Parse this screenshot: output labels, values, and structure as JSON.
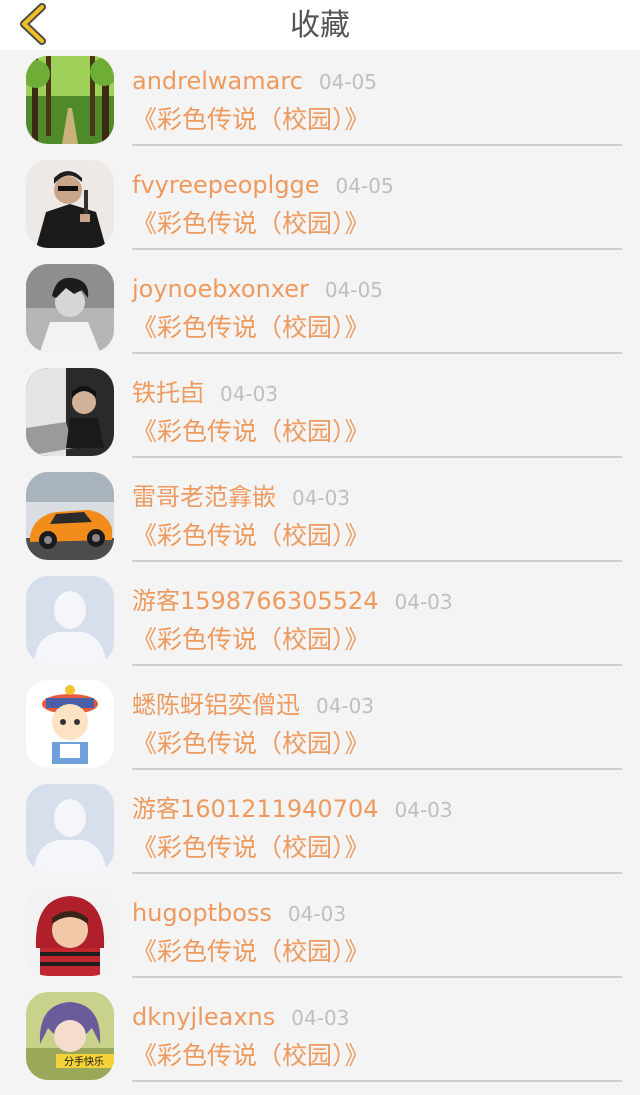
{
  "header": {
    "title": "收藏",
    "back_icon": "chevron-left-icon",
    "accent": "#f0c020"
  },
  "items": [
    {
      "name": "andrelwamarc",
      "date": "04-05",
      "book": "《彩色传说（校园）》",
      "avatar": "forest-path"
    },
    {
      "name": "fvyreepeoplgge",
      "date": "04-05",
      "book": "《彩色传说（校园）》",
      "avatar": "man-with-gun"
    },
    {
      "name": "joynoebxonxer",
      "date": "04-05",
      "book": "《彩色传说（校园）》",
      "avatar": "bw-portrait"
    },
    {
      "name": "铁托卣",
      "date": "04-03",
      "book": "《彩色传说（校园）》",
      "avatar": "person-at-desk"
    },
    {
      "name": "雷哥老范搻嵌",
      "date": "04-03",
      "book": "《彩色传说（校园）》",
      "avatar": "orange-sports-car"
    },
    {
      "name": "游客1598766305524",
      "date": "04-03",
      "book": "《彩色传说（校园）》",
      "avatar": "default-silhouette"
    },
    {
      "name": "蟋陈蚜铝奕僧迅",
      "date": "04-03",
      "book": "《彩色传说（校园）》",
      "avatar": "cartoon-boy"
    },
    {
      "name": "游客1601211940704",
      "date": "04-03",
      "book": "《彩色传说（校园）》",
      "avatar": "default-silhouette"
    },
    {
      "name": "hugoptboss",
      "date": "04-03",
      "book": "《彩色传说（校园）》",
      "avatar": "child-red-hood"
    },
    {
      "name": "dknyjleaxns",
      "date": "04-03",
      "book": "《彩色传说（校园）》",
      "avatar": "girl-portrait",
      "avatar_caption": "分手快乐"
    }
  ]
}
